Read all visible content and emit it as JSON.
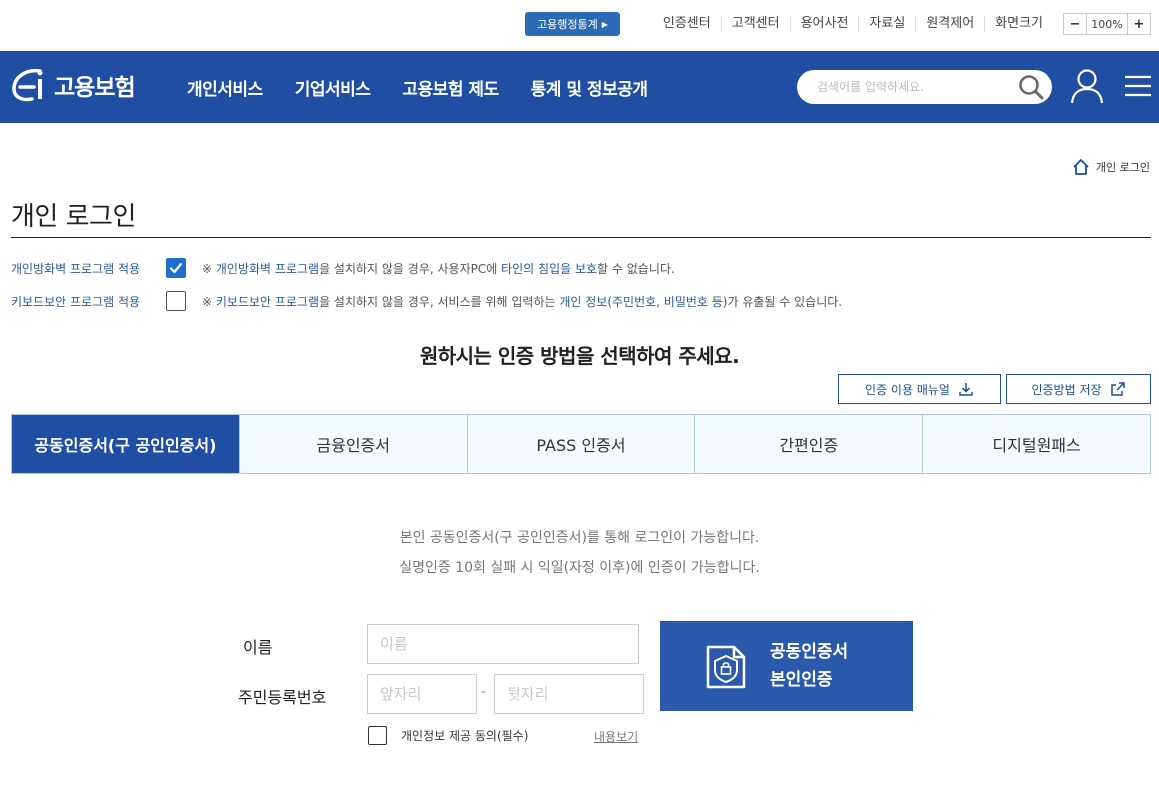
{
  "util": {
    "stats_label": "고용행정통계",
    "links": [
      "인증센터",
      "고객센터",
      "용어사전",
      "자료실",
      "원격제어",
      "화면크기"
    ],
    "zoom_minus": "−",
    "zoom_value": "100%",
    "zoom_plus": "+"
  },
  "header": {
    "logo_text": "고용보험",
    "nav": [
      "개인서비스",
      "기업서비스",
      "고용보험 제도",
      "통계 및 정보공개"
    ],
    "search_placeholder": "검색어를 입력하세요."
  },
  "breadcrumb": {
    "label": "개인 로그인"
  },
  "page": {
    "title": "개인 로그인"
  },
  "security": {
    "firewall_label": "개인방화벽 프로그램 적용",
    "firewall_checked": true,
    "firewall_note_prefix": "※ ",
    "firewall_note_hl1": "개인방화벽 프로그램",
    "firewall_note_mid": "을 설치하지 않을 경우, 사용자PC에 ",
    "firewall_note_hl2": "타인의 침입을 보호",
    "firewall_note_end": "할 수 없습니다.",
    "keyboard_label": "키보드보안 프로그램 적용",
    "keyboard_checked": false,
    "keyboard_note_prefix": "※ ",
    "keyboard_note_hl1": "키보드보안 프로그램",
    "keyboard_note_mid": "을 설치하지 않을 경우, 서비스를 위해 입력하는 ",
    "keyboard_note_hl2": "개인 정보(주민번호, 비밀번호 등)",
    "keyboard_note_end": "가 유출될 수 있습니다."
  },
  "auth": {
    "heading": "원하시는 인증 방법을 선택하여 주세요.",
    "manual_button": "인증 이용 매뉴얼",
    "save_method_button": "인증방법 저장",
    "tabs": [
      "공동인증서(구 공인인증서)",
      "금융인증서",
      "PASS 인증서",
      "간편인증",
      "디지털원패스"
    ],
    "active_tab": 0,
    "info_line1": "본인 공동인증서(구 공인인증서)를 통해 로그인이 가능합니다.",
    "info_line2": "실명인증 10회 실패 시 익일(자정 이후)에 인증이 가능합니다."
  },
  "form": {
    "name_label": "이름",
    "name_placeholder": "이름",
    "rrn_label": "주민등록번호",
    "rrn_front_placeholder": "앞자리",
    "rrn_dash": "-",
    "rrn_back_placeholder": "뒷자리",
    "cert_button_line1": "공동인증서",
    "cert_button_line2": "본인인증",
    "agree_label": "개인정보 제공 동의(필수)",
    "view_link": "내용보기"
  },
  "colors": {
    "brand_navy": "#1f4ea2",
    "stats_blue": "#2b6bb5",
    "checkbox_blue": "#1f6fd0",
    "cert_button": "#2b5aad"
  }
}
